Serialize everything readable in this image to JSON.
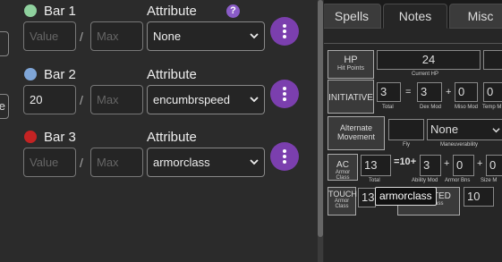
{
  "bars": [
    {
      "label": "Bar 1",
      "color": "#8fd19e",
      "value": "",
      "value_placeholder": "Value",
      "max": "",
      "max_placeholder": "Max",
      "attribute_label": "Attribute",
      "attribute_value": "None",
      "has_help": true
    },
    {
      "label": "Bar 2",
      "color": "#7fa6d8",
      "value": "20",
      "value_placeholder": "Value",
      "max": "",
      "max_placeholder": "Max",
      "attribute_label": "Attribute",
      "attribute_value": "encumbrspeed",
      "has_help": false
    },
    {
      "label": "Bar 3",
      "color": "#c42323",
      "value": "",
      "value_placeholder": "Value",
      "max": "",
      "max_placeholder": "Max",
      "attribute_label": "Attribute",
      "attribute_value": "armorclass",
      "has_help": false
    }
  ],
  "help_glyph": "?",
  "slash": "/",
  "edge_button_label": "e",
  "sheet": {
    "tabs": [
      "Spells",
      "Notes",
      "Misc"
    ],
    "hp": {
      "label": "HP",
      "sub": "Hit Points",
      "current": "24",
      "current_label": "Current HP"
    },
    "initiative": {
      "label": "INITIATIVE",
      "total": "3",
      "total_label": "Total",
      "dex": "3",
      "dex_label": "Dex Mod",
      "misc": "0",
      "misc_label": "Miso Mod",
      "temp": "0",
      "temp_label": "Temp M"
    },
    "movement": {
      "label_line1": "Alternate",
      "label_line2": "Movement",
      "fly_label": "Fly",
      "maneuverability": "None",
      "maneuverability_label": "Maneuverability"
    },
    "ac": {
      "label": "AC",
      "sub": "Armor Class",
      "total": "13",
      "total_label": "Total",
      "base": "10",
      "ability": "3",
      "ability_label": "Ability Mod",
      "armor": "0",
      "armor_label": "Armor Bns",
      "size": "0",
      "size_label": "Size M"
    },
    "touch": {
      "label": "TOUCH",
      "sub1": "Armor",
      "sub2": "Class",
      "value": "13",
      "ff_label": "OTED",
      "ff_sub": "Armor Class",
      "ff_value": "10"
    },
    "tooltip": "armorclass"
  },
  "colors": {
    "accent_purple": "#7b3fae",
    "help_purple": "#8a5cc7"
  }
}
